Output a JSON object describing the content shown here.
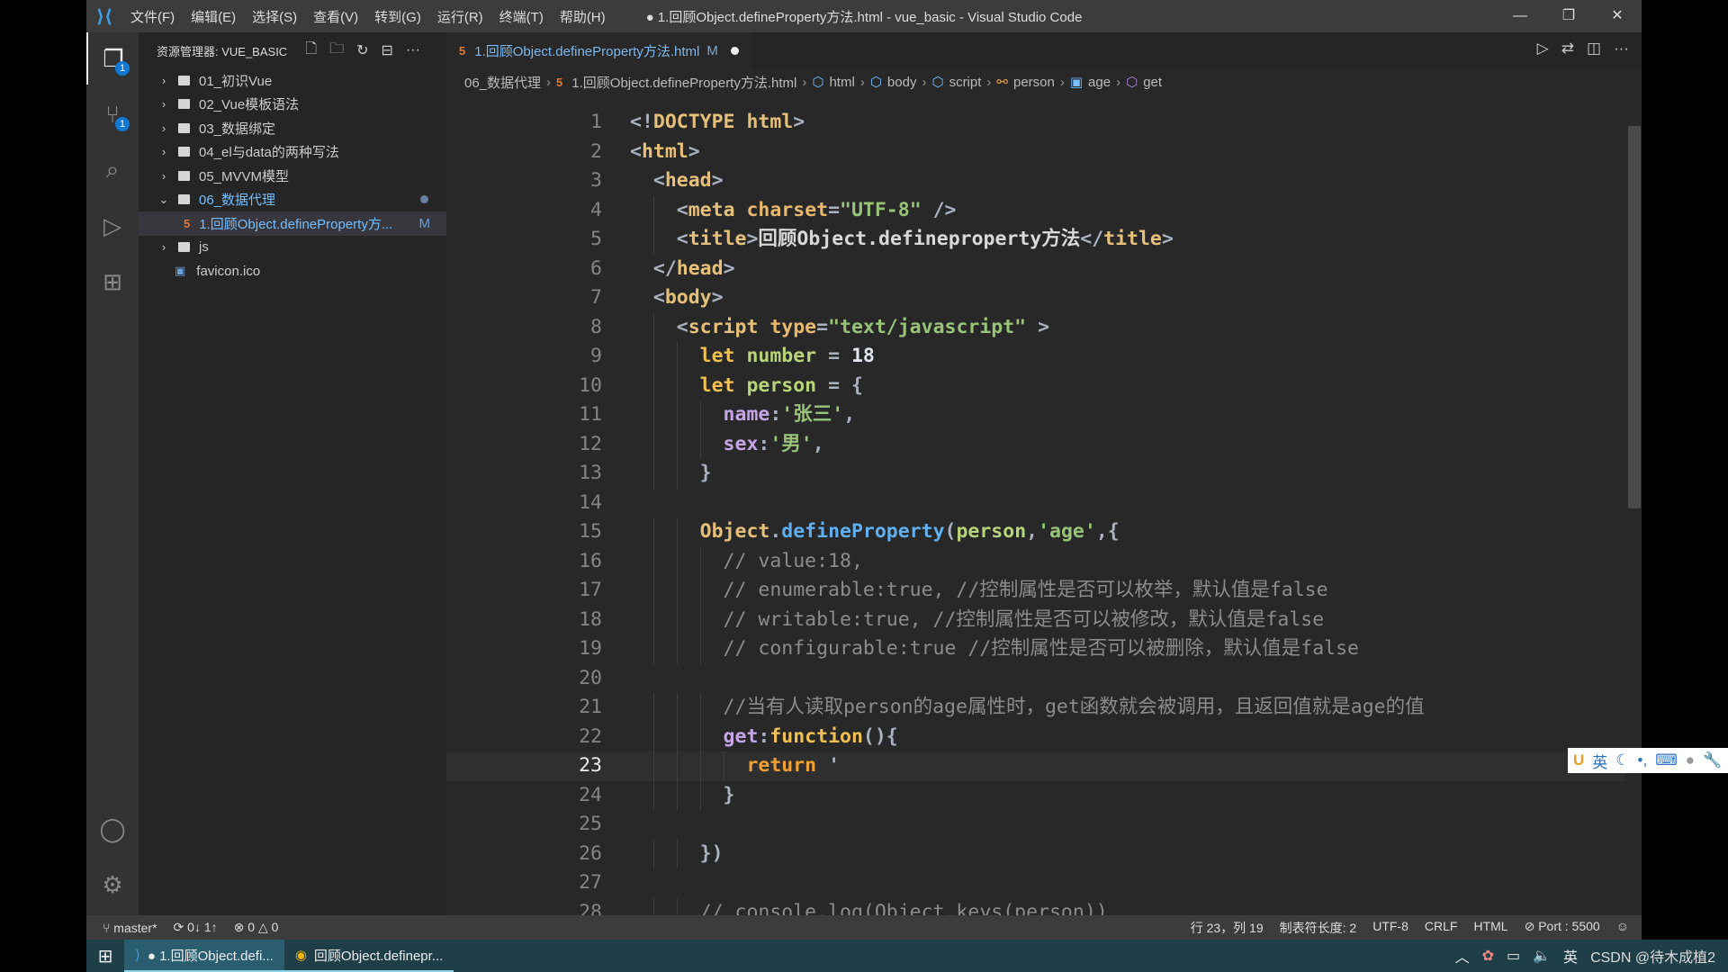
{
  "window": {
    "title": "● 1.回顾Object.defineProperty方法.html - vue_basic - Visual Studio Code",
    "menu": [
      "文件(F)",
      "编辑(E)",
      "选择(S)",
      "查看(V)",
      "转到(G)",
      "运行(R)",
      "终端(T)",
      "帮助(H)"
    ]
  },
  "activity": {
    "explorer_badge": "1",
    "scm_badge": "1"
  },
  "sidebar": {
    "title": "资源管理器: VUE_BASIC",
    "items": [
      {
        "label": "01_初识Vue",
        "type": "folder"
      },
      {
        "label": "02_Vue模板语法",
        "type": "folder"
      },
      {
        "label": "03_数据绑定",
        "type": "folder"
      },
      {
        "label": "04_el与data的两种写法",
        "type": "folder"
      },
      {
        "label": "05_MVVM模型",
        "type": "folder"
      },
      {
        "label": "06_数据代理",
        "type": "folder-open"
      },
      {
        "label": "1.回顾Object.defineProperty方...",
        "type": "file",
        "status": "M"
      },
      {
        "label": "js",
        "type": "folder"
      },
      {
        "label": "favicon.ico",
        "type": "ico"
      }
    ]
  },
  "tab": {
    "label": "1.回顾Object.defineProperty方法.html",
    "status": "M"
  },
  "breadcrumb": [
    "06_数据代理",
    "1.回顾Object.defineProperty方法.html",
    "html",
    "body",
    "script",
    "person",
    "age",
    "get"
  ],
  "code": [
    [
      [
        "<!",
        "br"
      ],
      [
        "DOCTYPE html",
        "tag"
      ],
      [
        ">",
        "br"
      ]
    ],
    [
      [
        "<",
        "br"
      ],
      [
        "html",
        "tag"
      ],
      [
        ">",
        "br"
      ]
    ],
    [
      [
        "  <",
        "br"
      ],
      [
        "head",
        "tag"
      ],
      [
        ">",
        "br"
      ]
    ],
    [
      [
        "    <",
        "br"
      ],
      [
        "meta ",
        "tag"
      ],
      [
        "charset",
        "attr"
      ],
      [
        "=",
        "br"
      ],
      [
        "\"UTF-8\"",
        "str"
      ],
      [
        " />",
        "br"
      ]
    ],
    [
      [
        "    <",
        "br"
      ],
      [
        "title",
        "tag"
      ],
      [
        ">",
        "br"
      ],
      [
        "回顾Object.defineproperty方法",
        "pl"
      ],
      [
        "</",
        "br"
      ],
      [
        "title",
        "tag"
      ],
      [
        ">",
        "br"
      ]
    ],
    [
      [
        "  </",
        "br"
      ],
      [
        "head",
        "tag"
      ],
      [
        ">",
        "br"
      ]
    ],
    [
      [
        "  <",
        "br"
      ],
      [
        "body",
        "tag"
      ],
      [
        ">",
        "br"
      ]
    ],
    [
      [
        "    <",
        "br"
      ],
      [
        "script ",
        "tag"
      ],
      [
        "type",
        "attr"
      ],
      [
        "=",
        "br"
      ],
      [
        "\"text/javascript\"",
        "str"
      ],
      [
        " >",
        "br"
      ]
    ],
    [
      [
        "      let ",
        "kw"
      ],
      [
        "number",
        "var"
      ],
      [
        " = ",
        "br"
      ],
      [
        "18",
        "num"
      ]
    ],
    [
      [
        "      let ",
        "kw"
      ],
      [
        "person",
        "var"
      ],
      [
        " = {",
        "br"
      ]
    ],
    [
      [
        "        name",
        "prop"
      ],
      [
        ":",
        "br"
      ],
      [
        "'张三'",
        "str"
      ],
      [
        ",",
        "br"
      ]
    ],
    [
      [
        "        sex",
        "prop"
      ],
      [
        ":",
        "br"
      ],
      [
        "'男'",
        "str"
      ],
      [
        ",",
        "br"
      ]
    ],
    [
      [
        "      }",
        "br"
      ]
    ],
    [
      [
        "",
        "br"
      ]
    ],
    [
      [
        "      Object",
        "tag"
      ],
      [
        ".",
        "br"
      ],
      [
        "defineProperty",
        "fn"
      ],
      [
        "(",
        "br"
      ],
      [
        "person",
        "var"
      ],
      [
        ",",
        "br"
      ],
      [
        "'age'",
        "str"
      ],
      [
        ",{",
        "br"
      ]
    ],
    [
      [
        "        // value:18,",
        "cm"
      ]
    ],
    [
      [
        "        // enumerable:true, //控制属性是否可以枚举，默认值是false",
        "cm"
      ]
    ],
    [
      [
        "        // writable:true, //控制属性是否可以被修改，默认值是false",
        "cm"
      ]
    ],
    [
      [
        "        // configurable:true //控制属性是否可以被删除，默认值是false",
        "cm"
      ]
    ],
    [
      [
        "",
        "br"
      ]
    ],
    [
      [
        "        //当有人读取person的age属性时，get函数就会被调用，且返回值就是age的值",
        "cm"
      ]
    ],
    [
      [
        "        get",
        "prop"
      ],
      [
        ":",
        "br"
      ],
      [
        "function",
        "kw"
      ],
      [
        "(){",
        "br"
      ]
    ],
    [
      [
        "          return ",
        "ret"
      ],
      [
        "'",
        "br"
      ]
    ],
    [
      [
        "        }",
        "br"
      ]
    ],
    [
      [
        "",
        "br"
      ]
    ],
    [
      [
        "      })",
        "br"
      ]
    ],
    [
      [
        "",
        "br"
      ]
    ],
    [
      [
        "      // console.log(Object.keys(person))",
        "cm"
      ]
    ]
  ],
  "current_line": 23,
  "ime": {
    "mode": "英"
  },
  "status": {
    "branch": "master*",
    "sync": "0↓ 1↑",
    "errors": "0",
    "warnings": "0",
    "position": "行 23，列 19",
    "tab_size": "制表符长度: 2",
    "encoding": "UTF-8",
    "eol": "CRLF",
    "language": "HTML",
    "port": "Port : 5500"
  },
  "taskbar": {
    "items": [
      "● 1.回顾Object.defi...",
      "回顾Object.definepr..."
    ],
    "ime": "英",
    "watermark": "CSDN @待木成植2"
  }
}
